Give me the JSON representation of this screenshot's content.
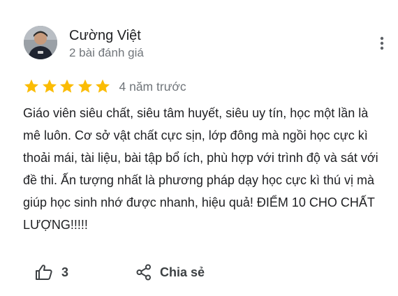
{
  "review": {
    "author": {
      "name": "Cường Việt",
      "meta": "2 bài đánh giá",
      "avatar": "avatar-photo"
    },
    "rating": 5,
    "rating_max": 5,
    "time": "4 năm trước",
    "text": "Giáo viên siêu chất, siêu tâm huyết, siêu uy tín, học một lần là mê luôn. Cơ sở vật chất cực sịn, lớp đông mà ngồi học cực kì thoải mái, tài liệu, bài tập bổ ích, phù hợp với trình độ và sát với đề thi. Ấn tượng nhất là phương pháp dạy học cực kì thú vị mà giúp học sinh nhớ được nhanh, hiệu quả! ĐIỂM 10 CHO CHẤT LƯỢNG!!!!!",
    "likes": "3",
    "share_label": "Chia sẻ"
  },
  "icons": {
    "more": "more-vert-icon",
    "like": "thumb-up-icon",
    "share": "share-icon",
    "star": "star-icon"
  },
  "colors": {
    "star": "#fbbc04",
    "text": "#202124",
    "secondary": "#70757a",
    "action": "#3c4043"
  }
}
